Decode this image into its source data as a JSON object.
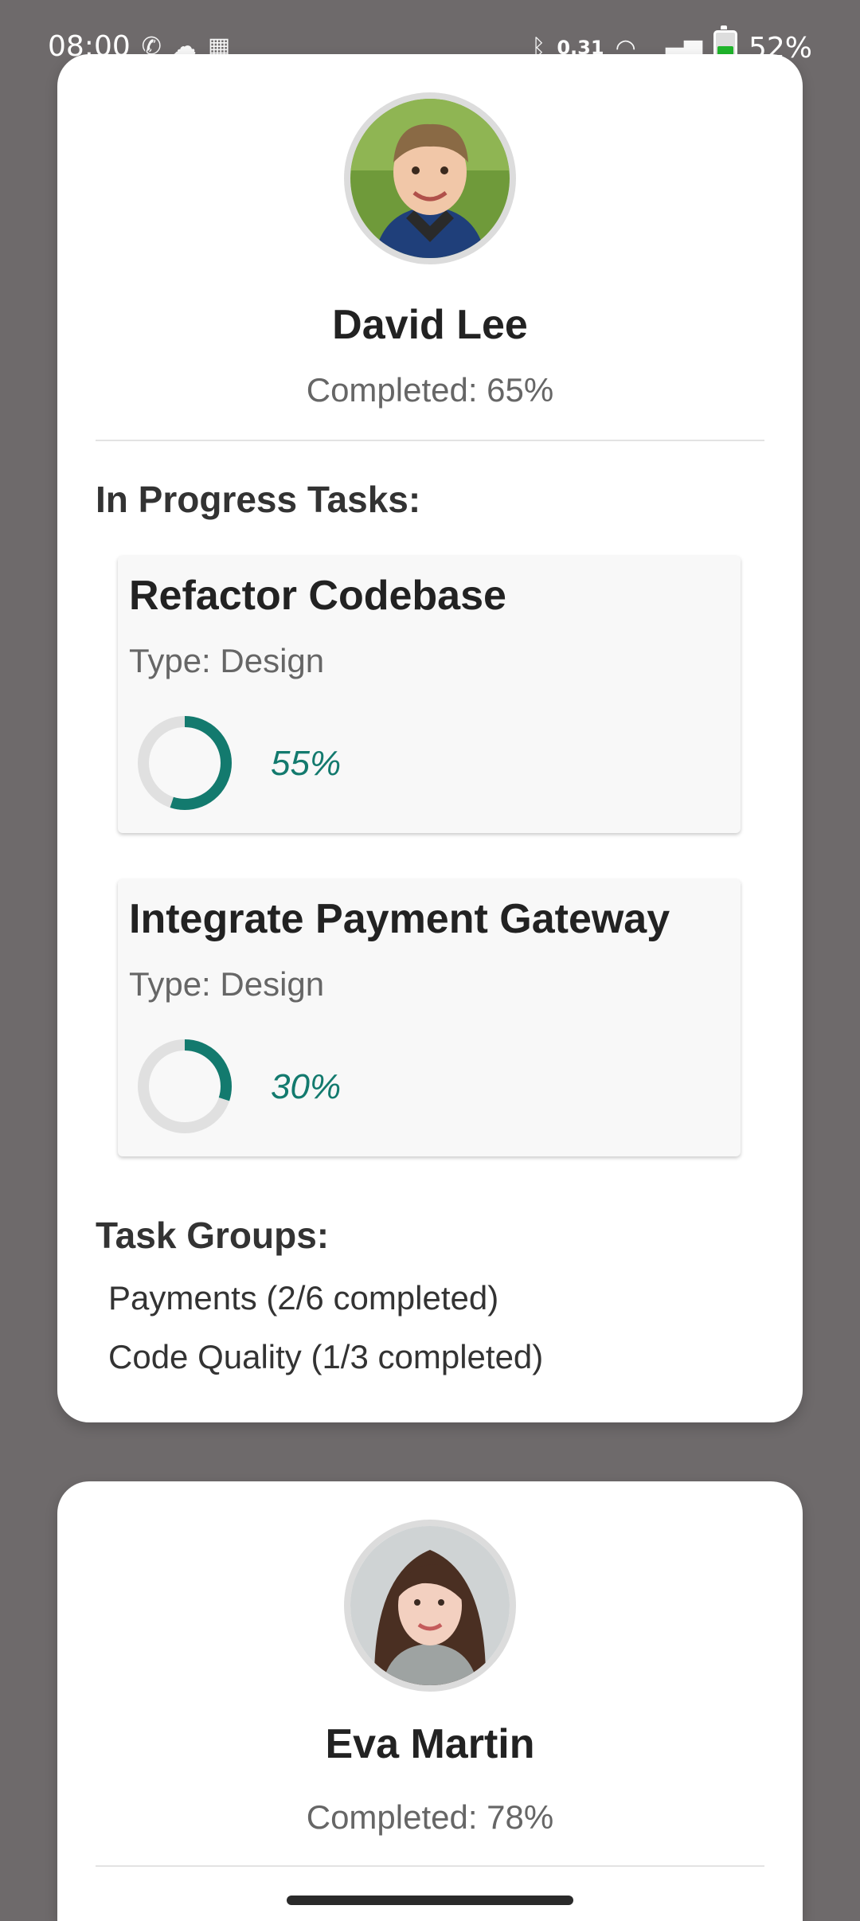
{
  "status_bar": {
    "time": "08:00",
    "network_speed": "0.31",
    "battery": "52%"
  },
  "members": [
    {
      "name": "David Lee",
      "completed": "Completed: 65%",
      "tasks_heading": "In Progress Tasks:",
      "tasks": [
        {
          "title": "Refactor Codebase",
          "type": "Type: Design",
          "progress_label": "55%",
          "progress": 0.55
        },
        {
          "title": "Integrate Payment Gateway",
          "type": "Type: Design",
          "progress_label": "30%",
          "progress": 0.3
        }
      ],
      "groups_heading": "Task Groups:",
      "groups": [
        "Payments (2/6 completed)",
        "Code Quality (1/3 completed)"
      ]
    },
    {
      "name": "Eva Martin",
      "completed": "Completed: 78%"
    }
  ],
  "colors": {
    "accent": "#137a6e",
    "track": "#e0e0e0",
    "backdrop": "#6e6a6b"
  }
}
